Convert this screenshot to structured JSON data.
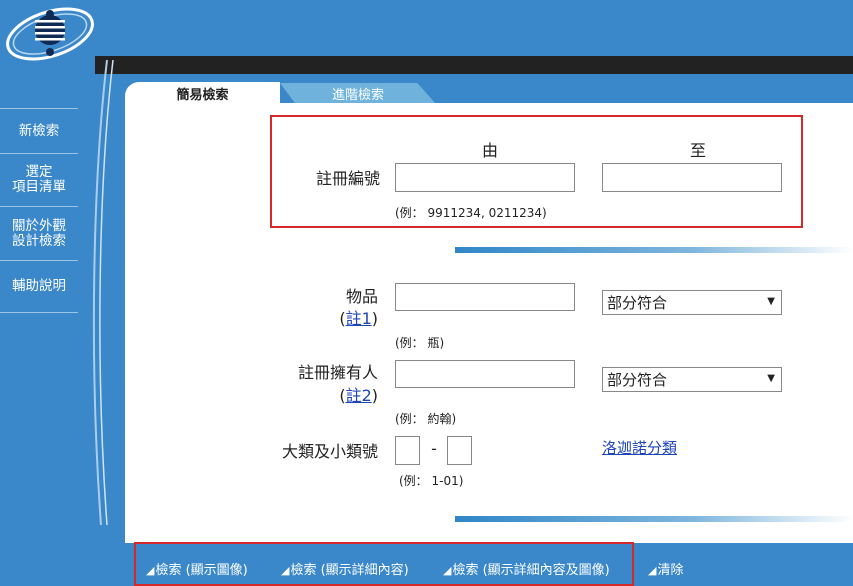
{
  "sidebar": {
    "items": [
      {
        "label": "新檢索"
      },
      {
        "label": "選定\n項目清單"
      },
      {
        "label": "關於外觀\n設計檢索"
      },
      {
        "label": "輔助說明"
      }
    ]
  },
  "tabs": {
    "simple": "簡易檢索",
    "advanced": "進階檢索"
  },
  "registration": {
    "label": "註冊編號",
    "from_label": "由",
    "to_label": "至",
    "from_value": "",
    "to_value": "",
    "example": "(例： 9911234, 0211234)"
  },
  "article": {
    "label": "物品",
    "note_open": "(",
    "note_link": "註1",
    "note_close": ")",
    "value": "",
    "match_option": "部分符合",
    "example": "(例： 瓶)"
  },
  "owner": {
    "label": "註冊擁有人",
    "note_open": "(",
    "note_link": "註2",
    "note_close": ")",
    "value": "",
    "match_option": "部分符合",
    "example": "(例： 約翰)"
  },
  "classification": {
    "label": "大類及小類號",
    "separator": "-",
    "link": "洛迦諾分類",
    "example": "(例： 1-01)"
  },
  "actions": {
    "search_image": "檢索 (顯示圖像)",
    "search_detail": "檢索 (顯示詳細內容)",
    "search_detail_image": "檢索 (顯示詳細內容及圖像)",
    "clear": "清除"
  },
  "colors": {
    "background": "#3a88c9",
    "highlight": "#d62a2a",
    "link": "#1f46b8"
  }
}
